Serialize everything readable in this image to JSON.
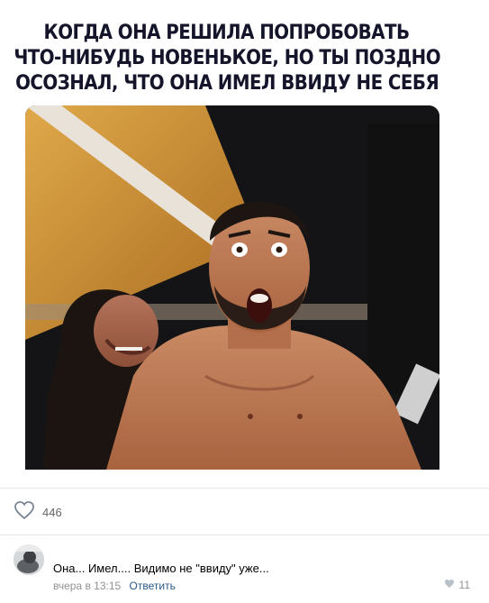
{
  "post": {
    "meme_caption_lines": [
      "Когда она решила попробовать",
      "что-нибудь новенькое, но ты поздно",
      "осознал, что она имел ввиду не себя"
    ],
    "image_icon": "photo-wrestlers",
    "likes_count": "446",
    "like_icon": "heart-outline-icon"
  },
  "comment": {
    "avatar_icon": "user-avatar",
    "text": "Она... Имел.... Видимо не \"ввиду\" уже...",
    "time": "вчера в 13:15",
    "reply_label": "Ответить",
    "likes_count": "11",
    "like_icon": "heart-icon"
  },
  "colors": {
    "link": "#2a5885",
    "meta": "#939393",
    "divider": "#e7e8ec"
  }
}
